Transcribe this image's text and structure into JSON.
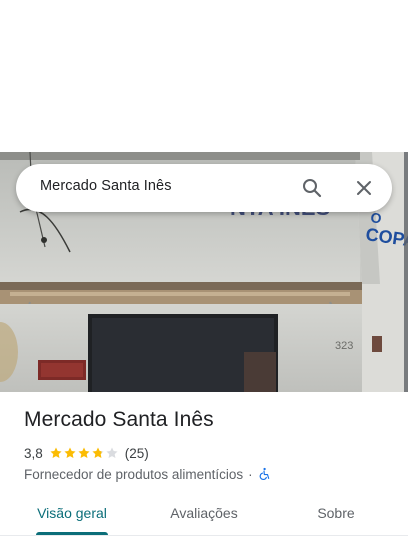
{
  "search": {
    "query": "Mercado Santa Inês"
  },
  "photo": {
    "door_number": "323"
  },
  "place": {
    "name": "Mercado Santa Inês",
    "rating": "3,8",
    "stars_filled_fraction": 0.76,
    "review_count": "(25)",
    "category": "Fornecedor de produtos alimentícios",
    "separator": "·",
    "accessibility_icon": "wheelchair-accessible-icon"
  },
  "tabs": [
    {
      "label": "Visão geral",
      "active": true
    },
    {
      "label": "Avaliações",
      "active": false
    },
    {
      "label": "Sobre",
      "active": false
    }
  ],
  "colors": {
    "accent": "#0b6e79",
    "star": "#fbbc04",
    "star_empty": "#dadce0",
    "accessibility": "#1a73e8"
  }
}
